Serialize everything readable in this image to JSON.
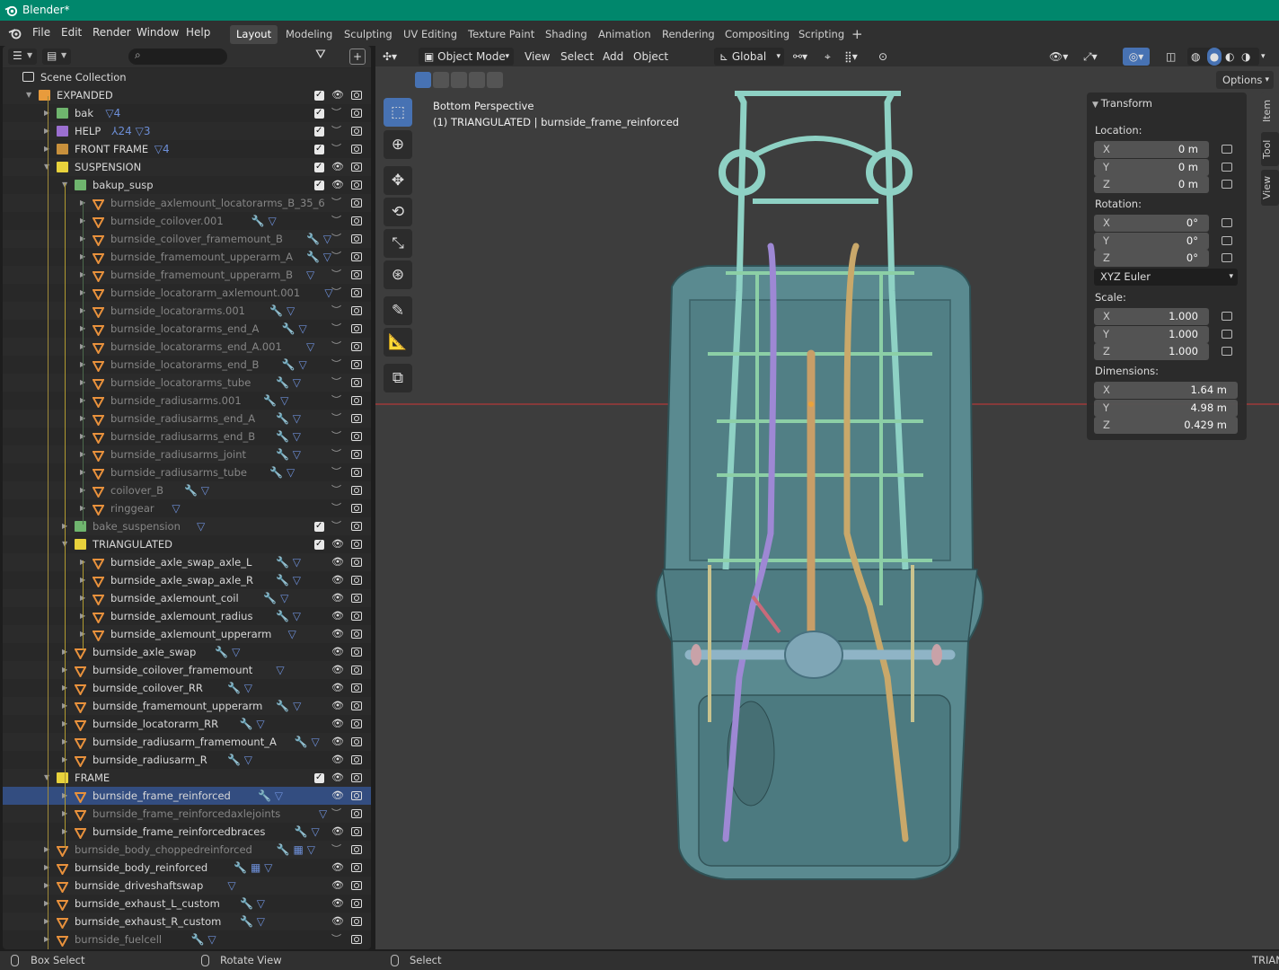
{
  "app": {
    "title": "Blender*"
  },
  "menu": {
    "items": [
      "File",
      "Edit",
      "Render",
      "Window",
      "Help"
    ]
  },
  "workspaces": {
    "tabs": [
      "Layout",
      "Modeling",
      "Sculpting",
      "UV Editing",
      "Texture Paint",
      "Shading",
      "Animation",
      "Rendering",
      "Compositing",
      "Scripting"
    ],
    "active": "Layout",
    "add_label": "+"
  },
  "outliner": {
    "root": "Scene Collection",
    "rows": [
      {
        "label": "EXPANDED",
        "type": "collection",
        "color": "#e89b3c",
        "depth": 1,
        "expanded": true,
        "check": true,
        "eye": true,
        "extras": ""
      },
      {
        "label": "bak",
        "type": "collection",
        "color": "#6fb56e",
        "depth": 2,
        "expanded": false,
        "check": true,
        "eye": false,
        "extras": "▽4"
      },
      {
        "label": "HELP",
        "type": "collection",
        "color": "#9b6fd0",
        "depth": 2,
        "expanded": false,
        "check": true,
        "eye": false,
        "extras": "⅄24 ▽3"
      },
      {
        "label": "FRONT FRAME",
        "type": "collection",
        "color": "#c8903c",
        "depth": 2,
        "expanded": false,
        "check": true,
        "eye": false,
        "extras": "▽4"
      },
      {
        "label": "SUSPENSION",
        "type": "collection",
        "color": "#e8d23c",
        "depth": 2,
        "expanded": true,
        "check": true,
        "eye": true,
        "extras": ""
      },
      {
        "label": "bakup_susp",
        "type": "collection",
        "color": "#6fb56e",
        "depth": 3,
        "expanded": true,
        "check": true,
        "eye": true,
        "extras": ""
      },
      {
        "label": "burnside_axlemount_locatorarms_B_35_6",
        "type": "object",
        "depth": 4,
        "dim": true,
        "eye": false,
        "extras": ""
      },
      {
        "label": "burnside_coilover.001",
        "type": "object",
        "depth": 4,
        "dim": true,
        "eye": false,
        "extras": "🔧 ▽"
      },
      {
        "label": "burnside_coilover_framemount_B",
        "type": "object",
        "depth": 4,
        "dim": true,
        "eye": false,
        "extras": "🔧 ▽"
      },
      {
        "label": "burnside_framemount_upperarm_A",
        "type": "object",
        "depth": 4,
        "dim": true,
        "eye": false,
        "extras": "🔧 ▽"
      },
      {
        "label": "burnside_framemount_upperarm_B",
        "type": "object",
        "depth": 4,
        "dim": true,
        "eye": false,
        "extras": "▽"
      },
      {
        "label": "burnside_locatorarm_axlemount.001",
        "type": "object",
        "depth": 4,
        "dim": true,
        "eye": false,
        "extras": "▽"
      },
      {
        "label": "burnside_locatorarms.001",
        "type": "object",
        "depth": 4,
        "dim": true,
        "eye": false,
        "extras": "🔧 ▽"
      },
      {
        "label": "burnside_locatorarms_end_A",
        "type": "object",
        "depth": 4,
        "dim": true,
        "eye": false,
        "extras": "🔧 ▽"
      },
      {
        "label": "burnside_locatorarms_end_A.001",
        "type": "object",
        "depth": 4,
        "dim": true,
        "eye": false,
        "extras": "▽"
      },
      {
        "label": "burnside_locatorarms_end_B",
        "type": "object",
        "depth": 4,
        "dim": true,
        "eye": false,
        "extras": "🔧 ▽"
      },
      {
        "label": "burnside_locatorarms_tube",
        "type": "object",
        "depth": 4,
        "dim": true,
        "eye": false,
        "extras": "🔧 ▽"
      },
      {
        "label": "burnside_radiusarms.001",
        "type": "object",
        "depth": 4,
        "dim": true,
        "eye": false,
        "extras": "🔧 ▽"
      },
      {
        "label": "burnside_radiusarms_end_A",
        "type": "object",
        "depth": 4,
        "dim": true,
        "eye": false,
        "extras": "🔧 ▽"
      },
      {
        "label": "burnside_radiusarms_end_B",
        "type": "object",
        "depth": 4,
        "dim": true,
        "eye": false,
        "extras": "🔧 ▽"
      },
      {
        "label": "burnside_radiusarms_joint",
        "type": "object",
        "depth": 4,
        "dim": true,
        "eye": false,
        "extras": "🔧 ▽"
      },
      {
        "label": "burnside_radiusarms_tube",
        "type": "object",
        "depth": 4,
        "dim": true,
        "eye": false,
        "extras": "🔧 ▽"
      },
      {
        "label": "coilover_B",
        "type": "object",
        "depth": 4,
        "dim": true,
        "eye": false,
        "extras": "🔧 ▽"
      },
      {
        "label": "ringgear",
        "type": "object",
        "depth": 4,
        "dim": true,
        "eye": false,
        "extras": "▽"
      },
      {
        "label": "bake_suspension",
        "type": "collection",
        "color": "#6fb56e",
        "depth": 3,
        "expanded": false,
        "dim": true,
        "check": true,
        "eye": false,
        "extras": "▽"
      },
      {
        "label": "TRIANGULATED",
        "type": "collection",
        "color": "#e8d23c",
        "depth": 3,
        "expanded": true,
        "check": true,
        "eye": true,
        "extras": ""
      },
      {
        "label": "burnside_axle_swap_axle_L",
        "type": "object",
        "depth": 4,
        "eye": true,
        "extras": "🔧 ▽"
      },
      {
        "label": "burnside_axle_swap_axle_R",
        "type": "object",
        "depth": 4,
        "eye": true,
        "extras": "🔧 ▽"
      },
      {
        "label": "burnside_axlemount_coil",
        "type": "object",
        "depth": 4,
        "eye": true,
        "extras": "🔧 ▽"
      },
      {
        "label": "burnside_axlemount_radius",
        "type": "object",
        "depth": 4,
        "eye": true,
        "extras": "🔧 ▽"
      },
      {
        "label": "burnside_axlemount_upperarm",
        "type": "object",
        "depth": 4,
        "eye": true,
        "extras": "▽"
      },
      {
        "label": "burnside_axle_swap",
        "type": "object",
        "depth": 3,
        "eye": true,
        "extras": "🔧 ▽"
      },
      {
        "label": "burnside_coilover_framemount",
        "type": "object",
        "depth": 3,
        "eye": true,
        "extras": "▽"
      },
      {
        "label": "burnside_coilover_RR",
        "type": "object",
        "depth": 3,
        "eye": true,
        "extras": "🔧 ▽"
      },
      {
        "label": "burnside_framemount_upperarm",
        "type": "object",
        "depth": 3,
        "eye": true,
        "extras": "🔧 ▽"
      },
      {
        "label": "burnside_locatorarm_RR",
        "type": "object",
        "depth": 3,
        "eye": true,
        "extras": "🔧 ▽"
      },
      {
        "label": "burnside_radiusarm_framemount_A",
        "type": "object",
        "depth": 3,
        "eye": true,
        "extras": "🔧 ▽"
      },
      {
        "label": "burnside_radiusarm_R",
        "type": "object",
        "depth": 3,
        "eye": true,
        "extras": "🔧 ▽"
      },
      {
        "label": "FRAME",
        "type": "collection",
        "color": "#e8d23c",
        "depth": 2,
        "expanded": true,
        "check": true,
        "eye": true,
        "extras": ""
      },
      {
        "label": "burnside_frame_reinforced",
        "type": "object",
        "depth": 3,
        "eye": true,
        "active": true,
        "extras": "🔧 ▽"
      },
      {
        "label": "burnside_frame_reinforcedaxlejoints",
        "type": "object",
        "depth": 3,
        "dim": true,
        "eye": false,
        "extras": "▽"
      },
      {
        "label": "burnside_frame_reinforcedbraces",
        "type": "object",
        "depth": 3,
        "eye": true,
        "extras": "🔧 ▽"
      },
      {
        "label": "burnside_body_choppedreinforced",
        "type": "object",
        "depth": 2,
        "dim": true,
        "eye": false,
        "extras": "🔧 ▦ ▽"
      },
      {
        "label": "burnside_body_reinforced",
        "type": "object",
        "depth": 2,
        "eye": true,
        "extras": "🔧 ▦ ▽"
      },
      {
        "label": "burnside_driveshaftswap",
        "type": "object",
        "depth": 2,
        "eye": true,
        "extras": "▽"
      },
      {
        "label": "burnside_exhaust_L_custom",
        "type": "object",
        "depth": 2,
        "eye": true,
        "extras": "🔧 ▽"
      },
      {
        "label": "burnside_exhaust_R_custom",
        "type": "object",
        "depth": 2,
        "eye": true,
        "extras": "🔧 ▽"
      },
      {
        "label": "burnside_fuelcell",
        "type": "object",
        "depth": 2,
        "dim": true,
        "eye": false,
        "extras": "🔧 ▽"
      }
    ]
  },
  "viewport": {
    "header": {
      "mode": "Object Mode",
      "menus": [
        "View",
        "Select",
        "Add",
        "Object"
      ],
      "orientation": "Global",
      "options": "Options"
    },
    "info_line1": "Bottom Perspective",
    "info_line2": "(1) TRIANGULATED | burnside_frame_reinforced"
  },
  "transform_panel": {
    "title": "Transform",
    "location_label": "Location:",
    "location": [
      {
        "axis": "X",
        "value": "0 m"
      },
      {
        "axis": "Y",
        "value": "0 m"
      },
      {
        "axis": "Z",
        "value": "0 m"
      }
    ],
    "rotation_label": "Rotation:",
    "rotation": [
      {
        "axis": "X",
        "value": "0°"
      },
      {
        "axis": "Y",
        "value": "0°"
      },
      {
        "axis": "Z",
        "value": "0°"
      }
    ],
    "rotation_mode": "XYZ Euler",
    "scale_label": "Scale:",
    "scale": [
      {
        "axis": "X",
        "value": "1.000"
      },
      {
        "axis": "Y",
        "value": "1.000"
      },
      {
        "axis": "Z",
        "value": "1.000"
      }
    ],
    "dimensions_label": "Dimensions:",
    "dimensions": [
      {
        "axis": "X",
        "value": "1.64 m"
      },
      {
        "axis": "Y",
        "value": "4.98 m"
      },
      {
        "axis": "Z",
        "value": "0.429 m"
      }
    ]
  },
  "side_tabs": [
    "Item",
    "Tool",
    "View"
  ],
  "statusbar": {
    "left": "Box Select",
    "middle": "Rotate View",
    "right": "Select",
    "far_right": "TRIAN"
  }
}
